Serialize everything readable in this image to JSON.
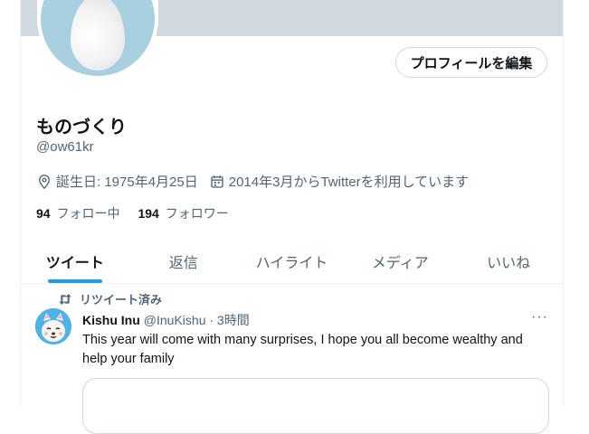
{
  "profile": {
    "name": "ものづくり",
    "handle": "@ow61kr",
    "birthday": "誕生日: 1975年4月25日",
    "joined": "2014年3月からTwitterを利用しています",
    "following_count": "94",
    "following_label": "フォロー中",
    "followers_count": "194",
    "followers_label": "フォロワー",
    "edit_button": "プロフィールを編集"
  },
  "tabs": [
    {
      "label": "ツイート",
      "active": true
    },
    {
      "label": "返信",
      "active": false
    },
    {
      "label": "ハイライト",
      "active": false
    },
    {
      "label": "メディア",
      "active": false
    },
    {
      "label": "いいね",
      "active": false
    }
  ],
  "tweet": {
    "retweet_label": "リツイート済み",
    "author_name": "Kishu Inu",
    "author_handle": "@InuKishu · 3時間",
    "text": "This year will come with many surprises, I hope you all become wealthy and help your family",
    "more": "···"
  },
  "colors": {
    "accent": "#1d9bf0",
    "banner": "#cfd9de",
    "avatar_bg": "#a8d0e0",
    "muted_text": "#536471"
  },
  "icons": {
    "location": "location-pin-icon",
    "calendar": "calendar-icon",
    "retweet": "retweet-icon",
    "more": "more-dots-icon"
  }
}
